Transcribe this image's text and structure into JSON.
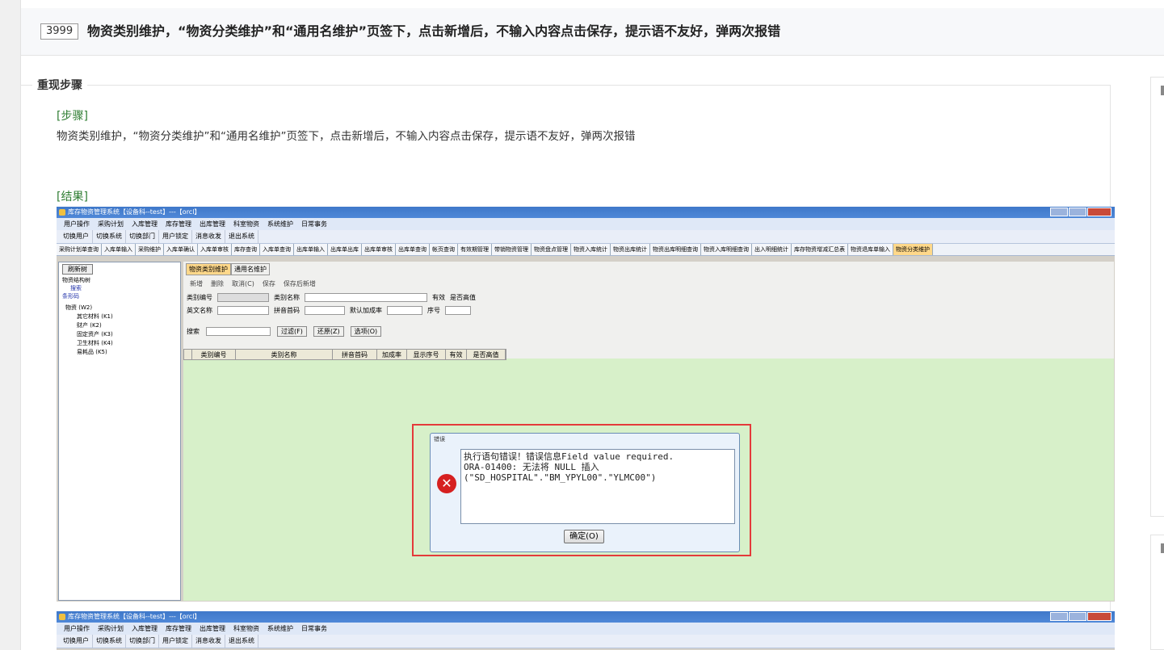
{
  "bug": {
    "id": "3999",
    "title": "物资类别维护，“物资分类维护”和“通用名维护”页签下，点击新增后，不输入内容点击保存，提示语不友好，弹两次报错"
  },
  "section": {
    "legend": "重现步骤",
    "steps_tag": "[步骤]",
    "steps_text": "物资类别维护，“物资分类维护”和“通用名维护”页签下，点击新增后，不输入内容点击保存，提示语不友好，弹两次报错",
    "result_tag": "[结果]"
  },
  "screenshot": {
    "window_title": "库存物资管理系统【设备科--test】---【orcl】",
    "menu": [
      "用户操作",
      "采购计划",
      "入库管理",
      "库存管理",
      "出库管理",
      "科室物资",
      "系统维护",
      "日常事务"
    ],
    "toolbar": [
      "切换用户",
      "切换系统",
      "切换部门",
      "用户锁定",
      "消息收发",
      "退出系统"
    ],
    "tabs": [
      "采购计划单查询",
      "入库单输入",
      "采购维护",
      "入库单确认",
      "入库单审核",
      "库存查询",
      "入库单查询",
      "出库单输入",
      "出库单出库",
      "出库单审核",
      "出库单查询",
      "帐页查询",
      "有效期管理",
      "带销物资管理",
      "物资盘点管理",
      "物资入库统计",
      "物资出库统计",
      "物资出库明细查询",
      "物资入库明细查询",
      "出入明细统计",
      "库存物资增减汇总表",
      "物资退库单输入",
      "物资分类维护"
    ],
    "left": {
      "refresh_btn": "刷新树",
      "tree_label": "物资结构树",
      "search_label": "搜索",
      "barcode_label": "条形码",
      "tree": [
        "物资 (W2)",
        "其它材料 (K1)",
        "财产 (K2)",
        "固定资产 (K3)",
        "卫生材料 (K4)",
        "易耗品 (K5)"
      ]
    },
    "subtabs": [
      "物资类别维护",
      "通用名维护"
    ],
    "actions": [
      "新增",
      "删除",
      "取消(C)",
      "保存",
      "保存后新增"
    ],
    "form": {
      "code": "类别编号",
      "name": "类别名称",
      "valid": "有效",
      "high_value": "是否高值",
      "en_name": "英文名称",
      "pinyin": "拼音首码",
      "markup": "默认加成率",
      "seq": "序号"
    },
    "filter": {
      "search": "搜索",
      "filter_btn": "过滤(F)",
      "restore_btn": "还原(Z)",
      "options_btn": "选项(O)"
    },
    "grid_columns": [
      "类别编号",
      "类别名称",
      "拼音首码",
      "加成率",
      "显示序号",
      "有效",
      "是否高值"
    ],
    "dialog": {
      "title": "错误",
      "message": "执行语句错误！错误信息Field value required.\nORA-01400: 无法将 NULL 插入\n(\"SD_HOSPITAL\".\"BM_YPYL00\".\"YLMC00\")",
      "ok": "确定(O)"
    }
  },
  "colors": {
    "tag_green": "#2e7d32",
    "highlight_red": "#e43a3a",
    "grid_green": "#d7f0c9"
  }
}
